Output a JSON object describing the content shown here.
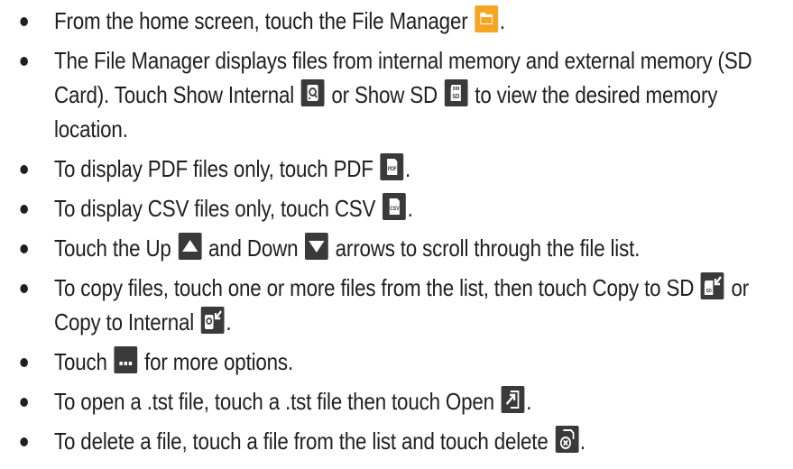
{
  "bullets": [
    {
      "t1": "From the home screen, touch the File Manager ",
      "t2": "."
    },
    {
      "t1": "The File Manager displays files from internal memory and external memory (SD Card). Touch Show Internal ",
      "t2": " or Show SD ",
      "t3": " to view the desired memory location."
    },
    {
      "t1": "To display PDF files only, touch PDF ",
      "t2": "."
    },
    {
      "t1": "To display CSV files only, touch CSV ",
      "t2": "."
    },
    {
      "t1": "Touch the Up ",
      "t2": " and Down ",
      "t3": " arrows to scroll through the file list."
    },
    {
      "t1": "To copy files, touch one or more files from the list, then touch Copy to SD ",
      "t2": " or Copy to Internal ",
      "t3": "."
    },
    {
      "t1": "Touch ",
      "t2": " for more options."
    },
    {
      "t1": "To open a .tst file, touch a .tst file then touch Open ",
      "t2": "."
    },
    {
      "t1": "To delete a file, touch a file from the list and touch delete ",
      "t2": "."
    }
  ],
  "icon_labels": {
    "sd": "SD",
    "pdf": "PDF",
    "csv": "CSV"
  },
  "icons": {
    "file_manager": "folder-icon",
    "show_internal": "internal-memory-icon",
    "show_sd": "sd-card-icon",
    "pdf": "pdf-file-icon",
    "csv": "csv-file-icon",
    "up": "up-arrow-icon",
    "down": "down-arrow-icon",
    "copy_to_sd": "copy-to-sd-icon",
    "copy_to_internal": "copy-to-internal-icon",
    "more": "more-options-icon",
    "open": "open-file-icon",
    "delete": "delete-file-icon"
  },
  "colors": {
    "text": "#1f1f1f",
    "folder_orange": "#f5a623",
    "icon_dark": "#3a3a3a"
  }
}
